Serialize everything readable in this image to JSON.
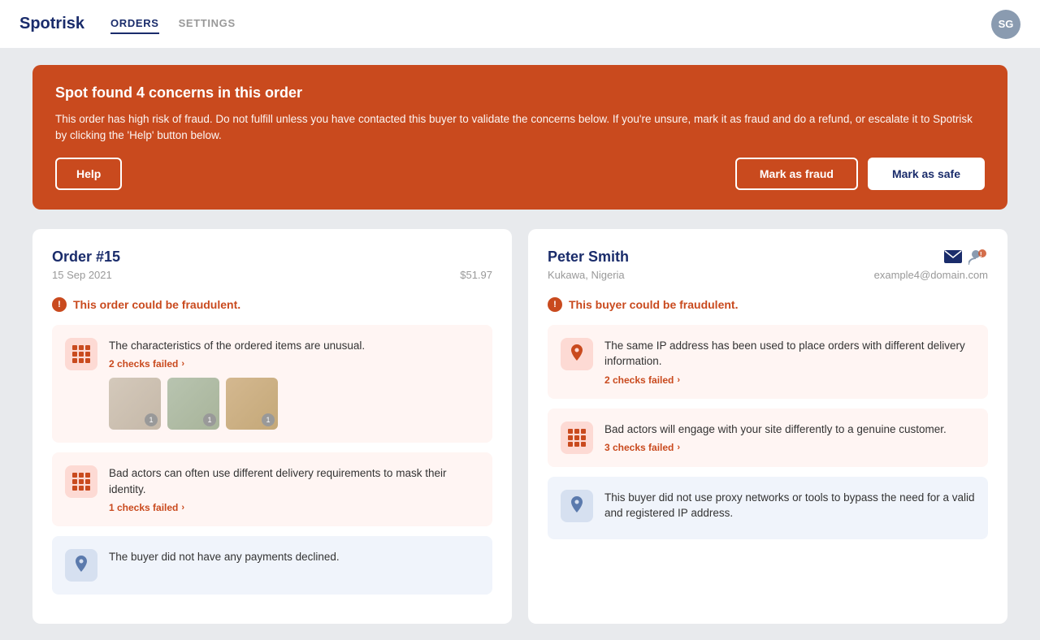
{
  "header": {
    "logo": "Spotrisk",
    "nav": [
      {
        "label": "ORDERS",
        "active": true
      },
      {
        "label": "SETTINGS",
        "active": false
      }
    ],
    "avatar_initials": "SG"
  },
  "alert": {
    "title": "Spot found 4 concerns in this order",
    "body": "This order has high risk of fraud. Do not fulfill unless you have contacted this buyer to validate the concerns below. If you're unsure, mark it as fraud and do a refund, or escalate it to Spotrisk by clicking the 'Help' button below.",
    "help_btn": "Help",
    "fraud_btn": "Mark as fraud",
    "safe_btn": "Mark as safe"
  },
  "order": {
    "title": "Order #15",
    "date": "15 Sep 2021",
    "amount": "$51.97",
    "fraud_warning": "This order could be fraudulent.",
    "concerns": [
      {
        "icon_type": "grid",
        "text": "The characteristics of the ordered items are unusual.",
        "checks": "2 checks failed",
        "has_thumbs": true,
        "thumb_badges": [
          "1",
          "1",
          "1"
        ]
      },
      {
        "icon_type": "grid",
        "text": "Bad actors can often use different delivery requirements to mask their identity.",
        "checks": "1 checks failed",
        "has_thumbs": false
      },
      {
        "icon_type": "grid",
        "text": "The buyer did not have any payments declined.",
        "checks": "",
        "has_thumbs": false,
        "card_type": "blue"
      }
    ]
  },
  "buyer": {
    "name": "Peter Smith",
    "location": "Kukawa, Nigeria",
    "email": "example4@domain.com",
    "fraud_warning": "This buyer could be fraudulent.",
    "concerns": [
      {
        "icon_type": "pin",
        "text": "The same IP address has been used to place orders with different delivery information.",
        "checks": "2 checks failed",
        "checks_color": "red"
      },
      {
        "icon_type": "grid",
        "text": "Bad actors will engage with your site differently to a genuine customer.",
        "checks": "3 checks failed",
        "checks_color": "red"
      },
      {
        "icon_type": "pin",
        "text": "This buyer did not use proxy networks or tools to bypass the need for a valid and registered IP address.",
        "checks": "",
        "checks_color": "blue",
        "card_type": "blue"
      }
    ]
  }
}
